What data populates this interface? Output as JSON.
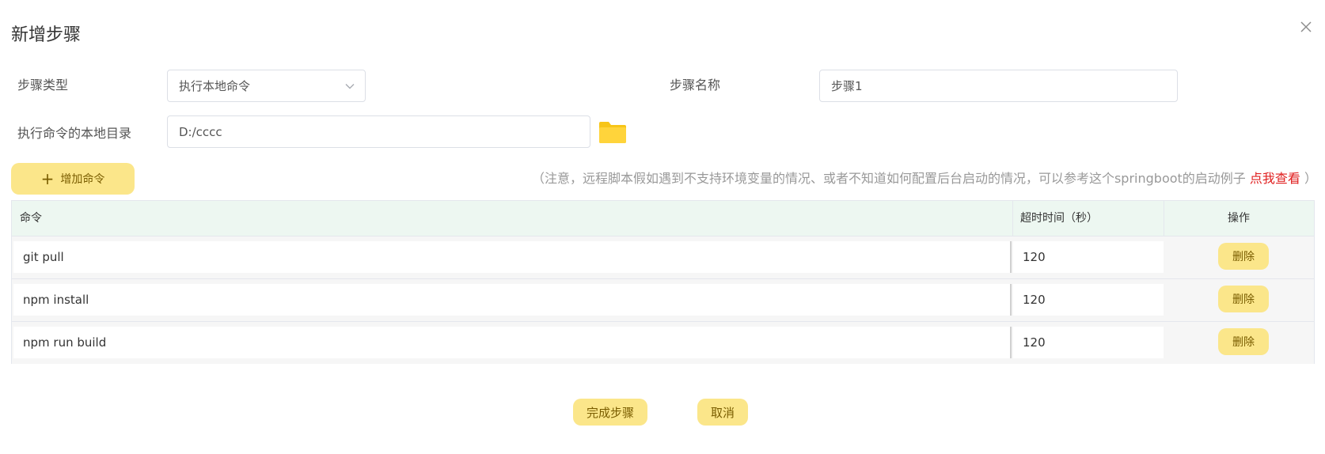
{
  "dialog": {
    "title": "新增步骤",
    "close_icon": "close-icon"
  },
  "form": {
    "step_type_label": "步骤类型",
    "step_type_value": "执行本地命令",
    "step_name_label": "步骤名称",
    "step_name_value": "步骤1",
    "local_dir_label": "执行命令的本地目录",
    "local_dir_value": "D:/cccc",
    "folder_icon": "folder-icon"
  },
  "toolbar": {
    "add_command_label": "增加命令",
    "notice_text": "（注意，远程脚本假如遇到不支持环境变量的情况、或者不知道如何配置后台启动的情况，可以参考这个springboot的启动例子 ",
    "notice_link": "点我查看",
    "notice_end": " ）"
  },
  "table": {
    "headers": {
      "command": "命令",
      "timeout": "超时时间（秒）",
      "operation": "操作"
    },
    "rows": [
      {
        "command": "git pull",
        "timeout": "120",
        "action": "删除"
      },
      {
        "command": "npm install",
        "timeout": "120",
        "action": "删除"
      },
      {
        "command": "npm run build",
        "timeout": "120",
        "action": "删除"
      }
    ]
  },
  "footer": {
    "confirm_label": "完成步骤",
    "cancel_label": "取消"
  },
  "colors": {
    "accent_button": "#fbe68a",
    "header_bg": "#edf7f1",
    "link": "#e02020",
    "folder": "#f7c518"
  }
}
